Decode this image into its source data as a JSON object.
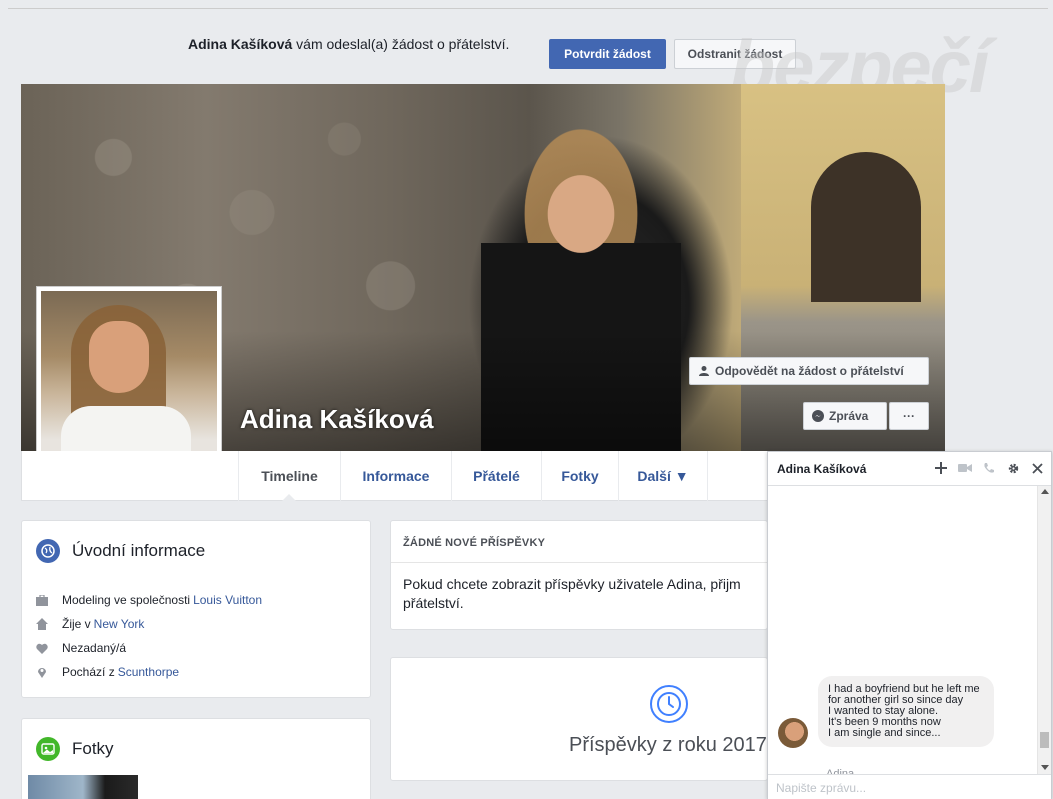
{
  "friend_request": {
    "sender_name": "Adina Kašíková",
    "message_rest": " vám odeslal(a) žádost o přátelství.",
    "confirm_label": "Potvrdit žádost",
    "remove_label": "Odstranit žádost"
  },
  "watermark": "bezpečí",
  "profile": {
    "name": "Adina Kašíková",
    "respond_button": "Odpovědět na žádost o přátelství",
    "message_button": "Zpráva",
    "more_button": "···"
  },
  "nav": {
    "tabs": [
      {
        "label": "Timeline"
      },
      {
        "label": "Informace"
      },
      {
        "label": "Přátelé"
      },
      {
        "label": "Fotky"
      },
      {
        "label": "Další ▼"
      }
    ]
  },
  "intro": {
    "title": "Úvodní informace",
    "items": [
      {
        "text": "Modeling ve společnosti ",
        "link": "Louis Vuitton",
        "icon": "briefcase-icon"
      },
      {
        "text": "Žije v ",
        "link": "New York",
        "icon": "home-icon"
      },
      {
        "text": "Nezadaný/á",
        "link": "",
        "icon": "heart-icon"
      },
      {
        "text": "Pochází z ",
        "link": "Scunthorpe",
        "icon": "location-pin-icon"
      }
    ]
  },
  "photos": {
    "title": "Fotky"
  },
  "posts": {
    "header": "ŽÁDNÉ NOVÉ PŘÍSPĚVKY",
    "body": "Pokud chcete zobrazit příspěvky uživatele Adina, přijm přátelství."
  },
  "year": {
    "label": "Příspěvky z roku 2017"
  },
  "chat": {
    "name": "Adina Kašíková",
    "message_lines": [
      "I had a boyfriend but he left me",
      "for another girl so since day",
      "I wanted to stay alone.",
      "It's been 9 months now",
      "I am single and since..."
    ],
    "sender": "Adina",
    "input_placeholder": "Napište zprávu..."
  },
  "colors": {
    "brand_blue": "#4267b2",
    "link_blue": "#365899",
    "page_bg": "#e9ebee"
  }
}
